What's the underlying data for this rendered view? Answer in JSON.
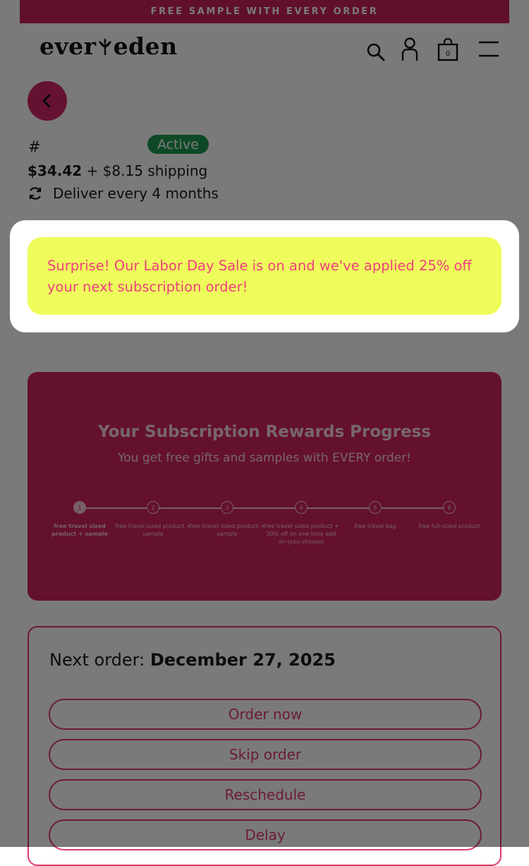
{
  "announcement": {
    "text": "FREE SAMPLE WITH EVERY ORDER"
  },
  "header": {
    "logo_left": "ever",
    "logo_right": "eden",
    "cart_count": "0"
  },
  "subscription": {
    "hash": "#",
    "status": "Active",
    "price": "$34.42",
    "shipping": " + $8.15 shipping",
    "frequency": "Deliver every 4 months"
  },
  "promo": {
    "text": "Surprise! Our Labor Day Sale is on and we've applied 25% off your next subscription order!"
  },
  "rewards": {
    "title": "Your Subscription Rewards Progress",
    "subtitle": "You get free gifts and samples with EVERY order!",
    "steps": [
      {
        "number": "1",
        "label": "free travel sized product + sample"
      },
      {
        "number": "2",
        "label": "free travel sized product + sample"
      },
      {
        "number": "3",
        "label": "free travel sized product + sample"
      },
      {
        "number": "4",
        "label": "free travel sized product + 30% off on one time add on (you choose)"
      },
      {
        "number": "5",
        "label": "free travel bag"
      },
      {
        "number": "6",
        "label": "free full-sized product"
      }
    ]
  },
  "next_order": {
    "label": "Next order: ",
    "date": "December 27, 2025"
  },
  "actions": {
    "order_now": "Order now",
    "skip": "Skip order",
    "reschedule": "Reschedule",
    "delay": "Delay"
  },
  "colors": {
    "brand_pink": "#d4246a",
    "promo_bg": "#eefc5c",
    "promo_text": "#ef3f7e",
    "active_green": "#1f9a50"
  }
}
